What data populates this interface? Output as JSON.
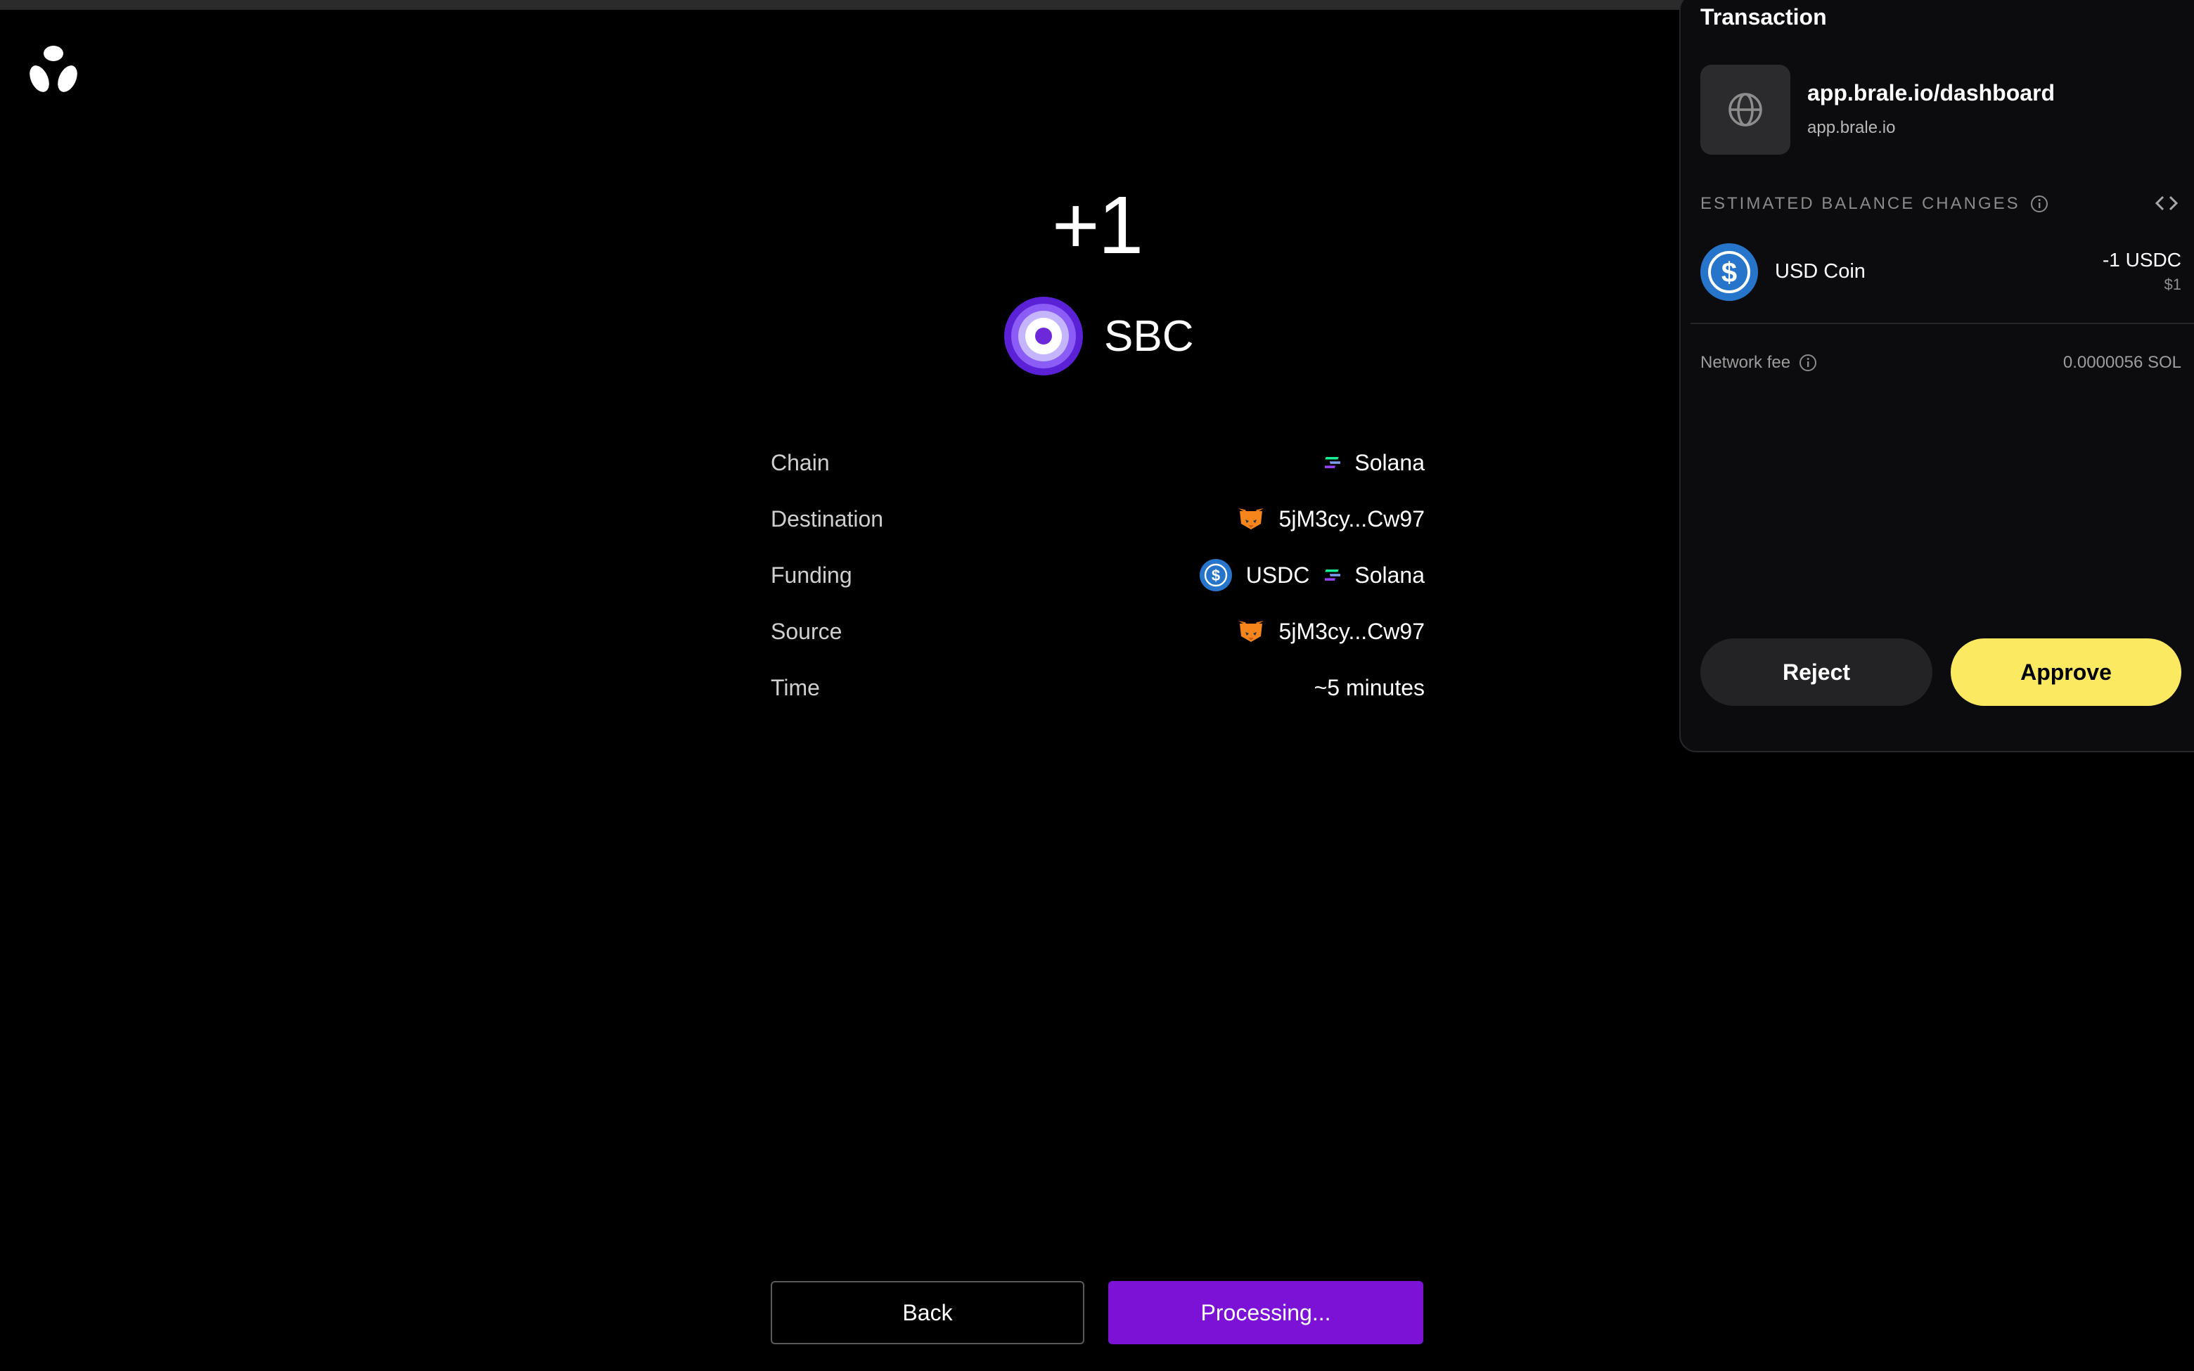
{
  "main": {
    "amount": "+1",
    "token": {
      "symbol": "SBC",
      "icon": "sbc-token-icon"
    },
    "details": {
      "chain": {
        "label": "Chain",
        "value": "Solana"
      },
      "destination": {
        "label": "Destination",
        "value": "5jM3cy...Cw97"
      },
      "funding": {
        "label": "Funding",
        "token": "USDC",
        "chain": "Solana"
      },
      "source": {
        "label": "Source",
        "value": "5jM3cy...Cw97"
      },
      "time": {
        "label": "Time",
        "value": "~5 minutes"
      }
    },
    "back_label": "Back",
    "processing_label": "Processing..."
  },
  "wallet": {
    "title": "Transaction",
    "site_name": "app.brale.io/dashboard",
    "site_host": "app.brale.io",
    "estimated_label": "ESTIMATED BALANCE CHANGES",
    "balance": {
      "name": "USD Coin",
      "amount": "-1 USDC",
      "usd": "$1"
    },
    "fee_label": "Network fee",
    "fee_value": "0.0000056 SOL",
    "reject_label": "Reject",
    "approve_label": "Approve"
  },
  "colors": {
    "accent_purple": "#7b12d6",
    "approve_yellow": "#fbe961",
    "usdc_blue": "#2775ca"
  }
}
